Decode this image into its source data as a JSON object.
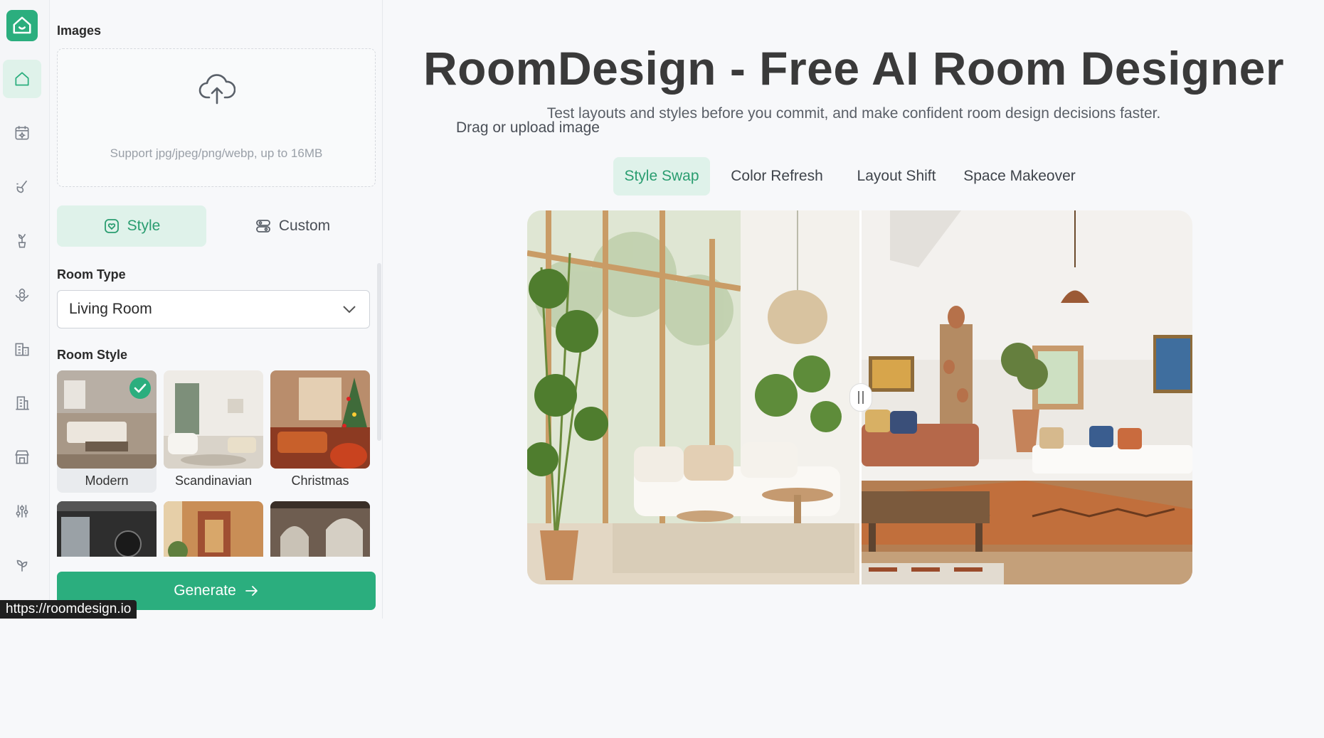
{
  "sidebar": {
    "items": [
      {
        "icon": "home-icon",
        "active": true
      },
      {
        "icon": "calendar-sparkle-icon",
        "active": false
      },
      {
        "icon": "paint-brush-icon",
        "active": false
      },
      {
        "icon": "plant-pot-icon",
        "active": false
      },
      {
        "icon": "flower-icon",
        "active": false
      },
      {
        "icon": "building-icon",
        "active": false
      },
      {
        "icon": "office-building-icon",
        "active": false
      },
      {
        "icon": "storefront-icon",
        "active": false
      },
      {
        "icon": "sliders-icon",
        "active": false
      },
      {
        "icon": "sprout-icon",
        "active": false
      }
    ]
  },
  "panel": {
    "images_label": "Images",
    "upload_main": "Drag or upload image",
    "upload_sub": "Support jpg/jpeg/png/webp, up to 16MB",
    "tab_style": "Style",
    "tab_custom": "Custom",
    "room_type_label": "Room Type",
    "room_type_value": "Living Room",
    "room_style_label": "Room Style",
    "styles": [
      {
        "name": "Modern",
        "selected": true
      },
      {
        "name": "Scandinavian",
        "selected": false
      },
      {
        "name": "Christmas",
        "selected": false
      }
    ],
    "generate_label": "Generate"
  },
  "main": {
    "title": "RoomDesign - Free AI Room Designer",
    "subtitle": "Test layouts and styles before you commit, and make confident room design decisions faster.",
    "tabs": [
      {
        "label": "Style Swap",
        "active": true
      },
      {
        "label": "Color Refresh",
        "active": false
      },
      {
        "label": "Layout Shift",
        "active": false
      },
      {
        "label": "Space Makeover",
        "active": false
      }
    ]
  },
  "status_url": "https://roomdesign.io",
  "colors": {
    "accent": "#2bae7e",
    "accent_light": "#dff2ea"
  }
}
